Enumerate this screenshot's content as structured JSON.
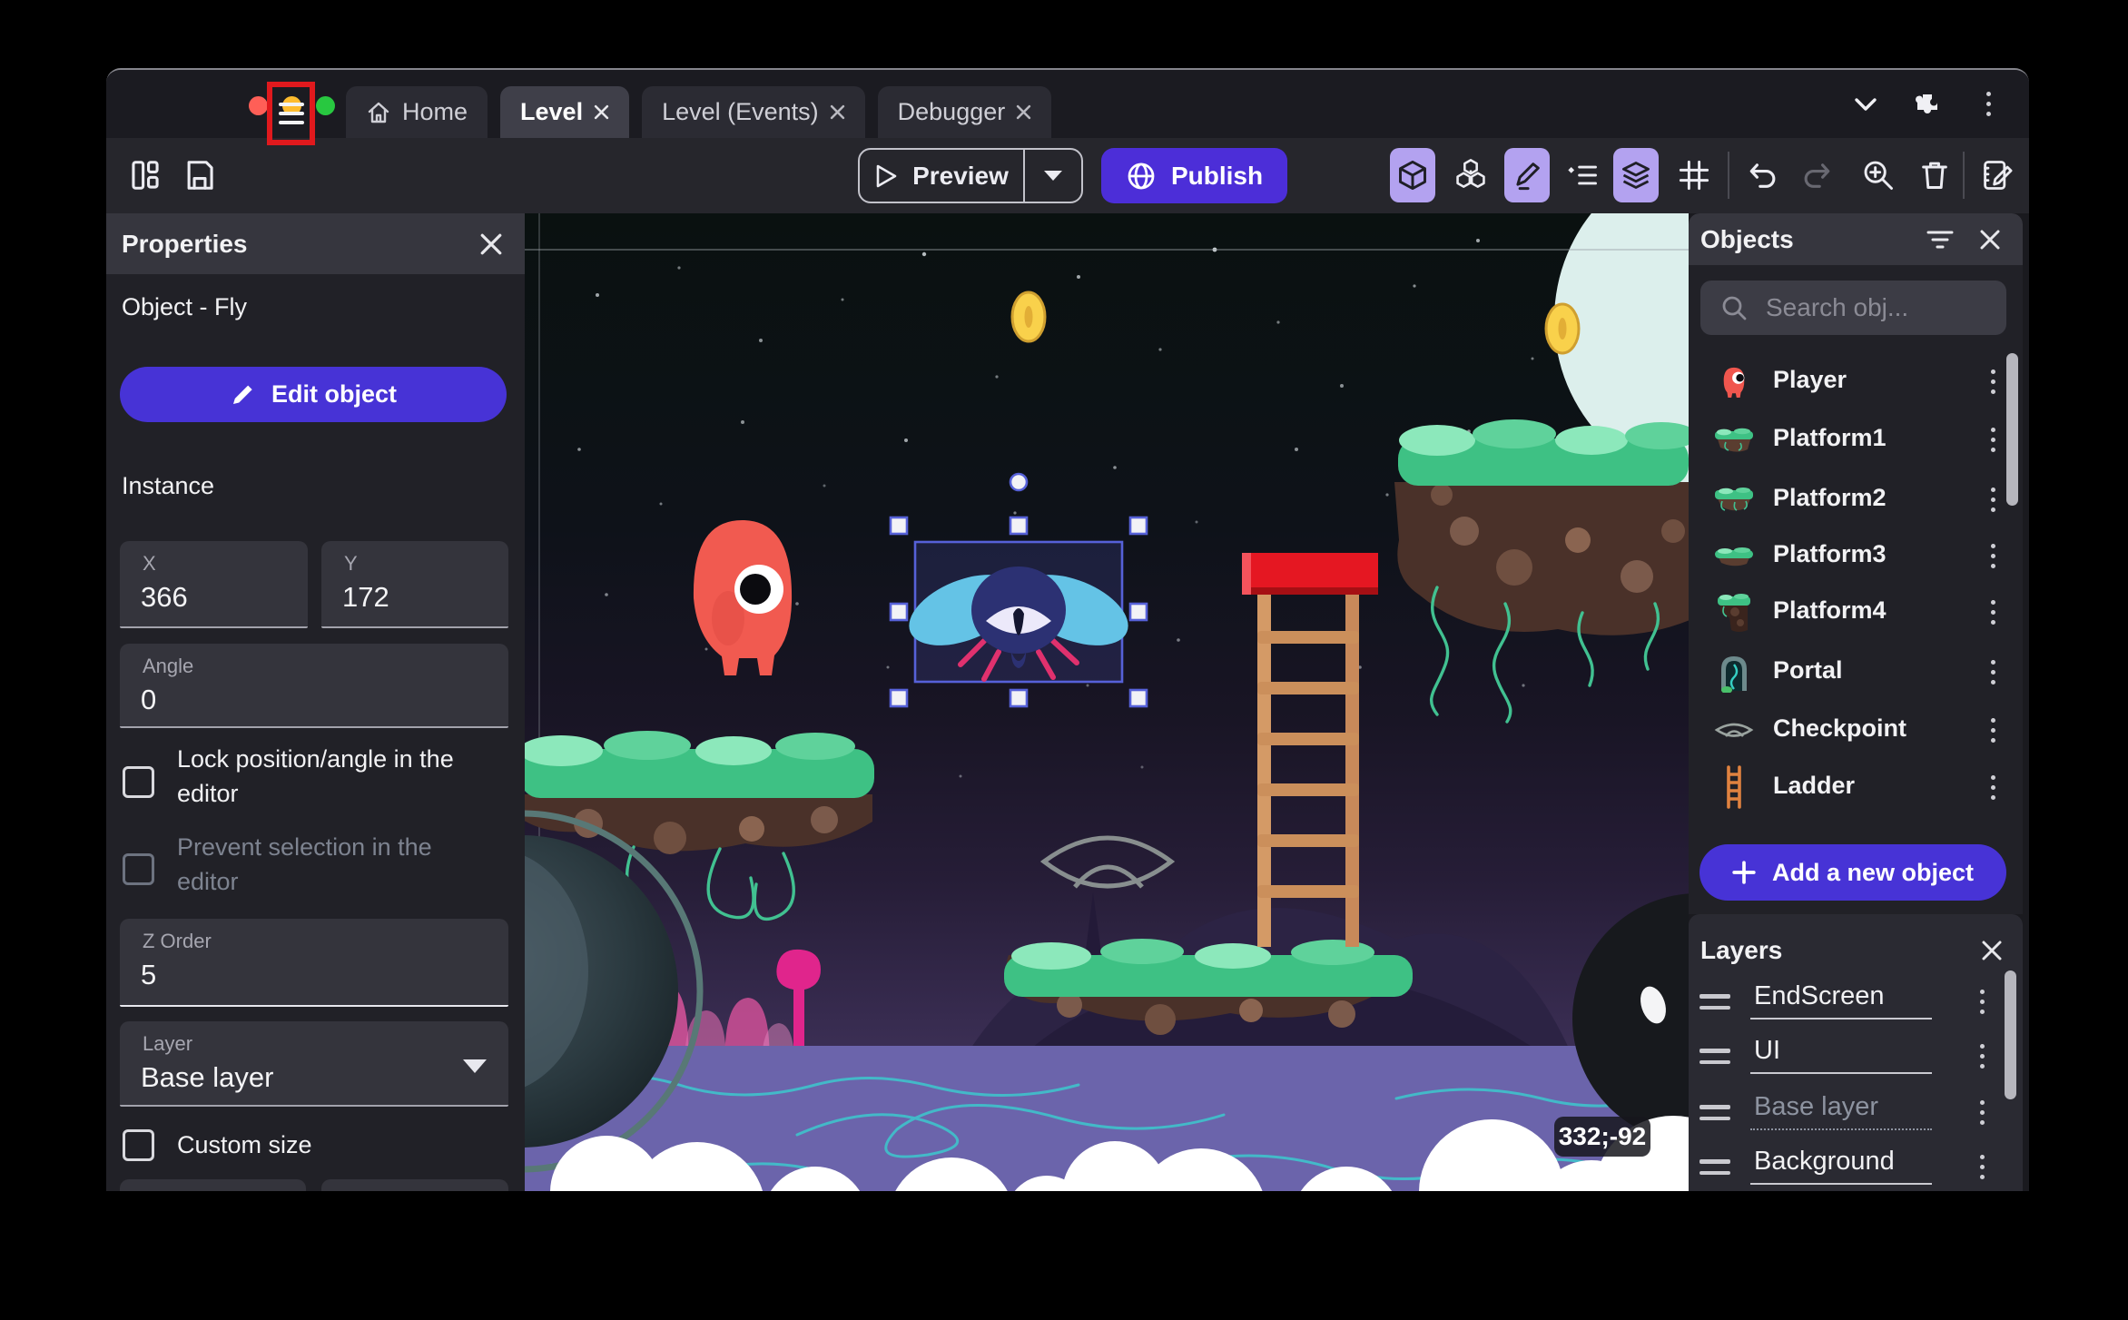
{
  "titlebar": {
    "tabs": [
      {
        "label": "Home"
      },
      {
        "label": "Level"
      },
      {
        "label": "Level (Events)"
      },
      {
        "label": "Debugger"
      }
    ]
  },
  "toolbar": {
    "preview": "Preview",
    "publish": "Publish"
  },
  "properties": {
    "title": "Properties",
    "object_heading": "Object  - Fly",
    "edit_object": "Edit object",
    "instance": "Instance",
    "x_label": "X",
    "x_value": "366",
    "y_label": "Y",
    "y_value": "172",
    "angle_label": "Angle",
    "angle_value": "0",
    "lock_label": "Lock position/angle in the editor",
    "prevent_label": "Prevent selection in the editor",
    "z_label": "Z Order",
    "z_value": "5",
    "layer_label": "Layer",
    "layer_value": "Base layer",
    "custom_size_label": "Custom size"
  },
  "objects": {
    "title": "Objects",
    "search_placeholder": "Search obj...",
    "add_button": "Add a new object",
    "items": [
      {
        "name": "Player"
      },
      {
        "name": "Platform1"
      },
      {
        "name": "Platform2"
      },
      {
        "name": "Platform3"
      },
      {
        "name": "Platform4"
      },
      {
        "name": "Portal"
      },
      {
        "name": "Checkpoint"
      },
      {
        "name": "Ladder"
      }
    ]
  },
  "layers": {
    "title": "Layers",
    "items": [
      {
        "name": "EndScreen"
      },
      {
        "name": "UI"
      },
      {
        "name": "Base layer"
      },
      {
        "name": "Background"
      }
    ]
  },
  "canvas": {
    "coords_tooltip": "332;-92"
  },
  "colors": {
    "accent": "#4733d6",
    "toggle_bg": "#b3a2f0",
    "selection": "#5661d8",
    "highlight_box": "#e0191d"
  }
}
